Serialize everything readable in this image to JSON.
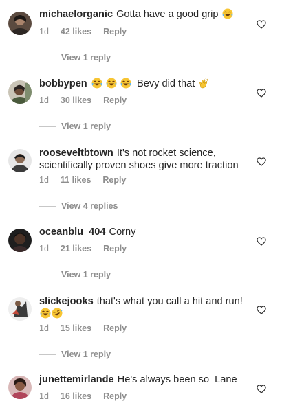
{
  "comments": [
    {
      "username": "michaelorganic",
      "text": "Gotta have a good grip",
      "emojis": [
        "laughing-tears"
      ],
      "time": "1d",
      "likes": "42 likes",
      "reply": "Reply",
      "view_replies": "View 1 reply"
    },
    {
      "username": "bobbypen",
      "text_before": "",
      "emojis_before": [
        "laughing-tears",
        "laughing-tears",
        "laughing-tears"
      ],
      "text": "Bevy did that",
      "emojis": [
        "clapping-hands"
      ],
      "time": "1d",
      "likes": "30 likes",
      "reply": "Reply",
      "view_replies": "View 1 reply"
    },
    {
      "username": "rooseveltbtown",
      "text": "It's not rocket science,",
      "text_line2": "scientifically proven shoes give more traction",
      "time": "1d",
      "likes": "11 likes",
      "reply": "Reply",
      "view_replies": "View 4 replies"
    },
    {
      "username": "oceanblu_404",
      "text": "Corny",
      "time": "1d",
      "likes": "21 likes",
      "reply": "Reply",
      "view_replies": "View 1 reply"
    },
    {
      "username": "slickejooks",
      "text": "that's what you call a hit and run!",
      "emojis_line2": [
        "laughing-tears",
        "rolling-laughing"
      ],
      "time": "1d",
      "likes": "15 likes",
      "reply": "Reply",
      "view_replies": "View 1 reply"
    },
    {
      "username": "junettemirlande",
      "text": "He's always been so  Lane",
      "time": "1d",
      "likes": "16 likes",
      "reply": "Reply"
    }
  ],
  "icons": {
    "like": "heart-outline-icon",
    "laughing": "face-with-tears-of-joy-icon",
    "rofl": "rolling-on-floor-laughing-icon",
    "clap": "clapping-hands-icon"
  },
  "colors": {
    "text": "#262626",
    "secondary": "#8e8e8e",
    "divider": "#c7c7c7",
    "emoji_yellow": "#f7c533"
  }
}
